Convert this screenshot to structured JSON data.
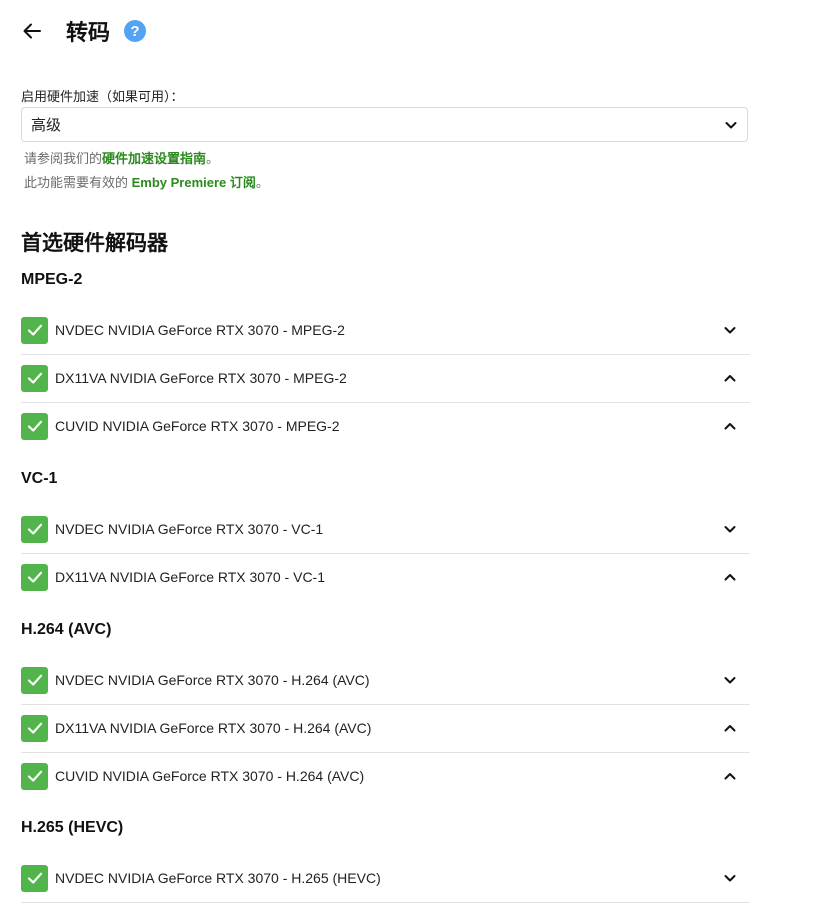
{
  "header": {
    "title": "转码",
    "help_label": "?"
  },
  "hw_accel": {
    "label": "启用硬件加速（如果可用）：",
    "selected": "高级"
  },
  "hints": {
    "line1_prefix": "请参阅我们的",
    "line1_link": "硬件加速设置指南",
    "line1_suffix": "。",
    "line2_prefix": "此功能需要有效的 ",
    "line2_link": "Emby Premiere 订阅",
    "line2_suffix": "。"
  },
  "section_title": "首选硬件解码器",
  "groups": [
    {
      "title": "MPEG-2",
      "items": [
        {
          "label": "NVDEC NVIDIA GeForce RTX 3070 - MPEG-2",
          "checked": true,
          "chevron": "down"
        },
        {
          "label": "DX11VA NVIDIA GeForce RTX 3070 - MPEG-2",
          "checked": true,
          "chevron": "up"
        },
        {
          "label": "CUVID NVIDIA GeForce RTX 3070 - MPEG-2",
          "checked": true,
          "chevron": "up"
        }
      ]
    },
    {
      "title": "VC-1",
      "items": [
        {
          "label": "NVDEC NVIDIA GeForce RTX 3070 - VC-1",
          "checked": true,
          "chevron": "down"
        },
        {
          "label": "DX11VA NVIDIA GeForce RTX 3070 - VC-1",
          "checked": true,
          "chevron": "up"
        }
      ]
    },
    {
      "title": "H.264 (AVC)",
      "items": [
        {
          "label": "NVDEC NVIDIA GeForce RTX 3070 - H.264 (AVC)",
          "checked": true,
          "chevron": "down"
        },
        {
          "label": "DX11VA NVIDIA GeForce RTX 3070 - H.264 (AVC)",
          "checked": true,
          "chevron": "up"
        },
        {
          "label": "CUVID NVIDIA GeForce RTX 3070 - H.264 (AVC)",
          "checked": true,
          "chevron": "up"
        }
      ]
    },
    {
      "title": "H.265 (HEVC)",
      "items": [
        {
          "label": "NVDEC NVIDIA GeForce RTX 3070 - H.265 (HEVC)",
          "checked": true,
          "chevron": "down"
        }
      ]
    }
  ],
  "colors": {
    "check": "#52b54b",
    "link": "#2b8a1e",
    "help": "#52a3f3"
  }
}
